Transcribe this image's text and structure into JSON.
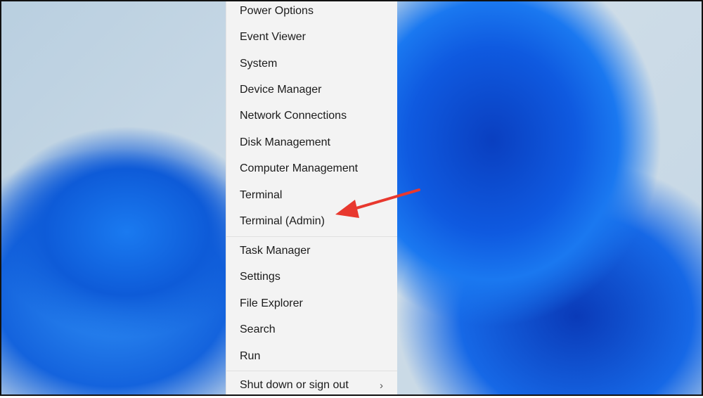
{
  "menu": {
    "items": [
      "Power Options",
      "Event Viewer",
      "System",
      "Device Manager",
      "Network Connections",
      "Disk Management",
      "Computer Management",
      "Terminal",
      "Terminal (Admin)"
    ],
    "items2": [
      "Task Manager",
      "Settings",
      "File Explorer",
      "Search",
      "Run"
    ],
    "shutdown": "Shut down or sign out"
  },
  "annotation": {
    "arrow_color": "#e8382e",
    "target": "Terminal (Admin)"
  }
}
